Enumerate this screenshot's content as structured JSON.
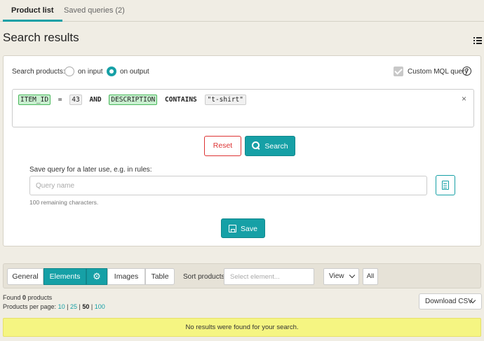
{
  "tabs": [
    {
      "label": "Product list",
      "active": true
    },
    {
      "label": "Saved queries (2)",
      "active": false
    }
  ],
  "page_title": "Search results",
  "icons": {
    "list": "list-icon",
    "help": "help-icon",
    "search": "search-icon",
    "doc": "document-icon",
    "save": "save-icon",
    "gear": "gear-icon",
    "clear": "close-icon",
    "chevron": "chevron-down-icon"
  },
  "colors": {
    "accent": "#16a0a6",
    "danger": "#d33333",
    "warning_bg": "#f5f582",
    "field_token": "#c9f0d0"
  },
  "search": {
    "label": "Search products:",
    "options": [
      {
        "label": "on input",
        "checked": false
      },
      {
        "label": "on output",
        "checked": true
      }
    ],
    "custom_mql_label": "Custom MQL query",
    "custom_mql_checked": true,
    "help_glyph": "?",
    "query_tokens": [
      {
        "text": "ITEM_ID",
        "kind": "field"
      },
      {
        "text": "=",
        "kind": "op"
      },
      {
        "text": "43",
        "kind": "num"
      },
      {
        "text": "AND",
        "kind": "keyword"
      },
      {
        "text": "DESCRIPTION",
        "kind": "field"
      },
      {
        "text": "CONTAINS",
        "kind": "keyword"
      },
      {
        "text": "\"t-shirt\"",
        "kind": "string"
      }
    ],
    "clear_glyph": "×",
    "reset_label": "Reset",
    "search_label": "Search"
  },
  "save_query": {
    "label": "Save query for a later use, e.g. in rules:",
    "placeholder": "Query name",
    "value": "",
    "remaining": "100 remaining characters.",
    "save_label": "Save"
  },
  "toolbar": {
    "views": [
      {
        "label": "General",
        "active": false
      },
      {
        "label": "Elements",
        "active": true
      },
      {
        "label": "Images",
        "active": false
      },
      {
        "label": "Table",
        "active": false
      }
    ],
    "gear_glyph": "⚙",
    "sort_label": "Sort products",
    "sort_placeholder": "Select element...",
    "view_label": "View",
    "all_label": "All"
  },
  "results": {
    "found_prefix": "Found",
    "found_count": "0",
    "found_suffix": "products",
    "per_page_label": "Products per page:",
    "per_page_options": [
      "10",
      "25",
      "50",
      "100"
    ],
    "per_page_current": "50",
    "download_label": "Download CSV",
    "empty_message": "No results were found for your search."
  }
}
